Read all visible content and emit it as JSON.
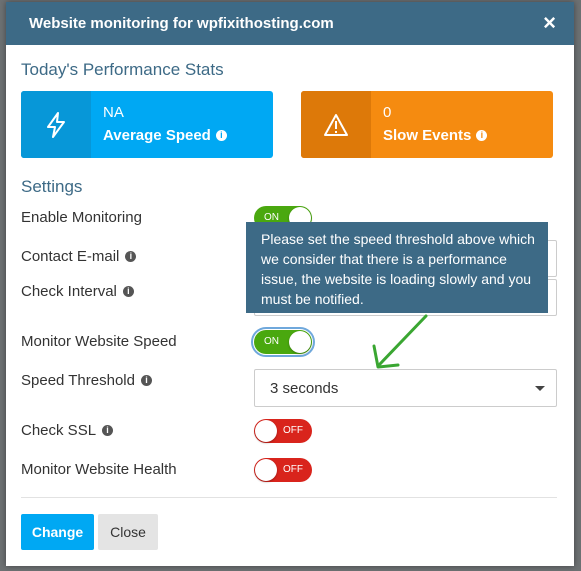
{
  "modal": {
    "title": "Website monitoring for wpfixithosting.com",
    "close_glyph": "×"
  },
  "stats": {
    "section_title": "Today's Performance Stats",
    "speed": {
      "value": "NA",
      "label": "Average Speed",
      "icon": "lightning-icon",
      "color": "#00a8f3"
    },
    "slow": {
      "value": "0",
      "label": "Slow Events",
      "icon": "warning-icon",
      "color": "#f58b10"
    }
  },
  "settings": {
    "section_title": "Settings",
    "enable_monitoring": {
      "label": "Enable Monitoring",
      "state": "ON"
    },
    "contact_email": {
      "label": "Contact E-mail",
      "value": ""
    },
    "check_interval": {
      "label": "Check Interval",
      "value": ""
    },
    "monitor_speed": {
      "label": "Monitor Website Speed",
      "state": "ON"
    },
    "speed_threshold": {
      "label": "Speed Threshold",
      "value": "3 seconds"
    },
    "check_ssl": {
      "label": "Check SSL",
      "state": "OFF"
    },
    "monitor_health": {
      "label": "Monitor Website Health",
      "state": "OFF"
    }
  },
  "tooltip": {
    "text": "Please set the speed threshold above which we consider that there is a performance issue, the website is loading slowly and you must be notified."
  },
  "footer": {
    "change_label": "Change",
    "close_label": "Close"
  },
  "colors": {
    "header": "#3d6a86",
    "toggle_on": "#4aa80f",
    "toggle_off": "#d9241c",
    "annotation_arrow": "#3aa632"
  }
}
